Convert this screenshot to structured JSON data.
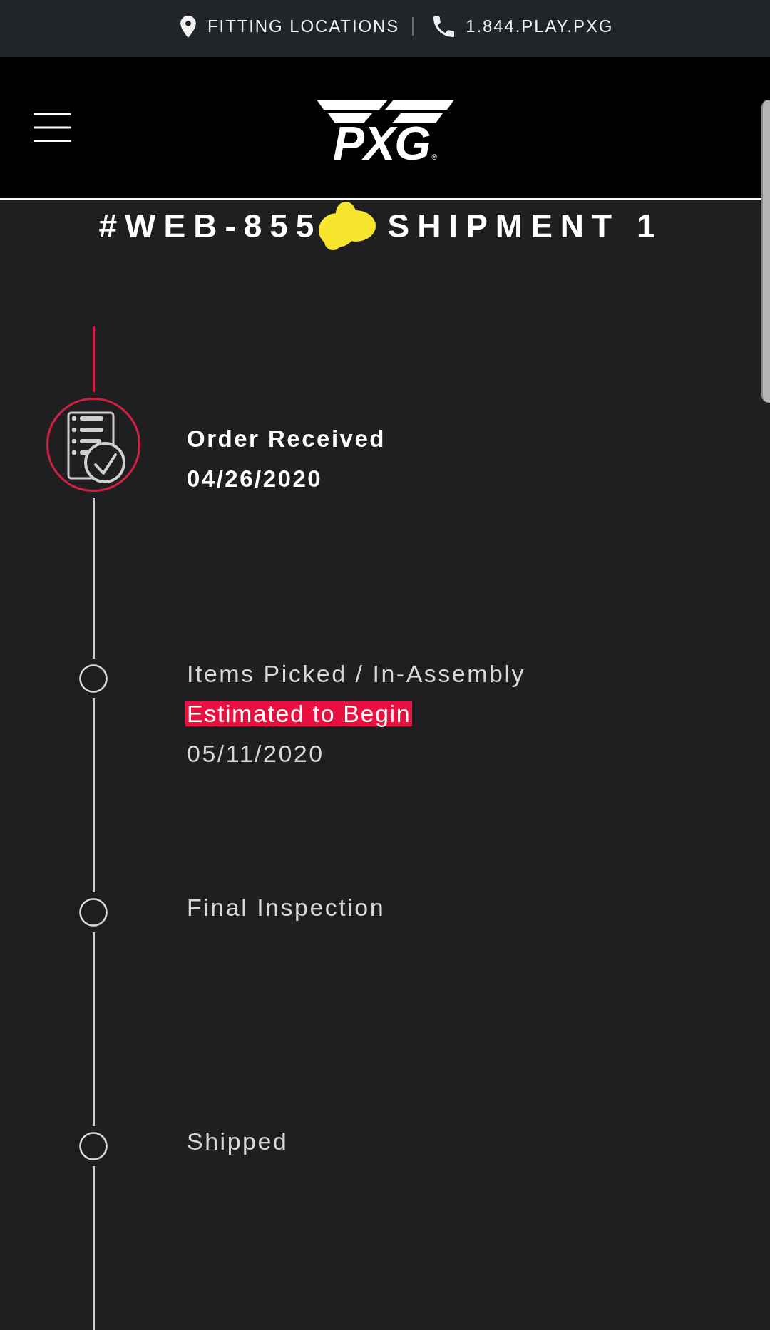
{
  "top_bar": {
    "links": [
      {
        "kind": "location",
        "label": "FITTING LOCATIONS"
      },
      {
        "kind": "phone",
        "label": "1.844.PLAY.PXG"
      }
    ]
  },
  "header": {
    "logo": {
      "text": "PXG",
      "mark": "®"
    }
  },
  "order_title": {
    "order_number": "#WEB-855",
    "redacted": true,
    "shipment": "SHIPMENT 1"
  },
  "timeline": {
    "steps": [
      {
        "label": "Order Received",
        "date": "04/26/2020",
        "completed": true
      },
      {
        "label": "Items Picked / In-Assembly",
        "note": "Estimated to Begin",
        "date": "05/11/2020",
        "completed": false
      },
      {
        "label": "Final Inspection",
        "completed": false
      },
      {
        "label": "Shipped",
        "completed": false
      }
    ]
  }
}
